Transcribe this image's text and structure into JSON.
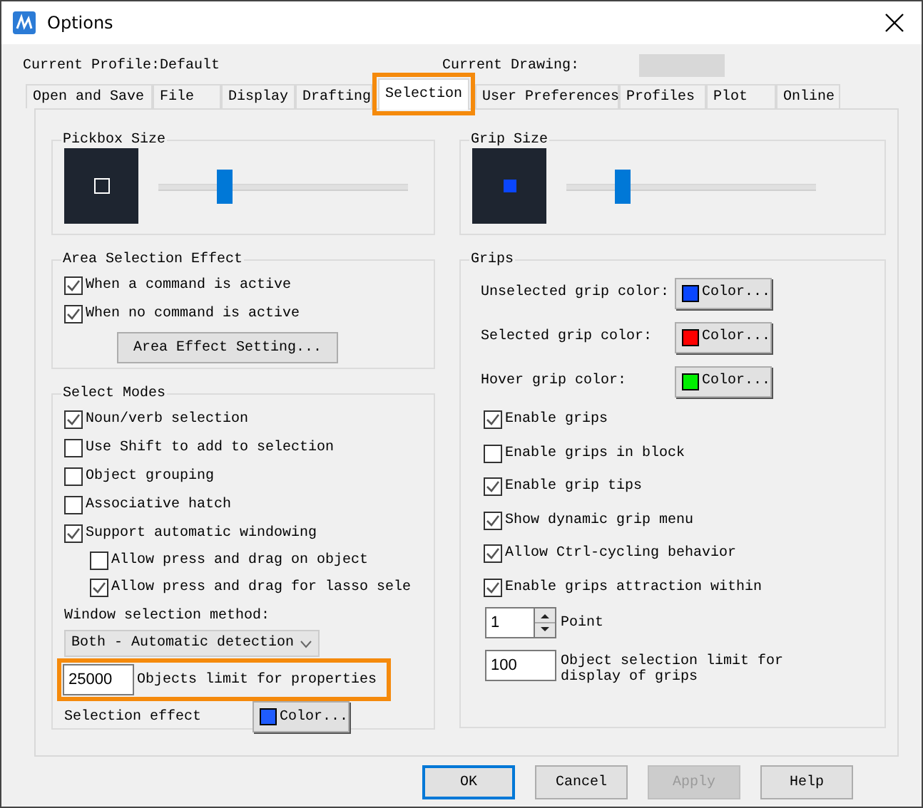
{
  "window": {
    "title": "Options"
  },
  "current_profile": "Current Profile:Default",
  "current_drawing_label": "Current Drawing:",
  "tabs": [
    {
      "label": "Open and Save",
      "selected": false,
      "highlighted": false
    },
    {
      "label": "File",
      "selected": false,
      "highlighted": false
    },
    {
      "label": "Display",
      "selected": false,
      "highlighted": false
    },
    {
      "label": "Drafting",
      "selected": false,
      "highlighted": false
    },
    {
      "label": "Selection",
      "selected": true,
      "highlighted": true
    },
    {
      "label": "User Preferences",
      "selected": false,
      "highlighted": false
    },
    {
      "label": "Profiles",
      "selected": false,
      "highlighted": false
    },
    {
      "label": "Plot",
      "selected": false,
      "highlighted": false
    },
    {
      "label": "Online",
      "selected": false,
      "highlighted": false
    }
  ],
  "pickbox_size": {
    "title": "Pickbox Size",
    "level": 0.26
  },
  "area_selection_effect": {
    "title": "Area Selection Effect",
    "checkboxes": [
      {
        "label": "When a command is active",
        "checked": true
      },
      {
        "label": "When no command is active",
        "checked": true
      }
    ],
    "button": "Area Effect Setting..."
  },
  "select_modes": {
    "title": "Select Modes",
    "checkboxes": [
      {
        "label": "Noun/verb selection",
        "checked": true
      },
      {
        "label": "Use Shift to add to selection",
        "checked": false
      },
      {
        "label": "Object grouping",
        "checked": false
      },
      {
        "label": "Associative hatch",
        "checked": false
      },
      {
        "label": "Support automatic windowing",
        "checked": true,
        "children": [
          {
            "label": "Allow press and drag on object",
            "checked": false
          },
          {
            "label": "Allow press and drag for lasso sele",
            "checked": true
          }
        ]
      }
    ],
    "window_selection_method": {
      "label": "Window selection method:",
      "value": "Both - Automatic detection"
    },
    "objects_limit": {
      "value": "25000",
      "label": "Objects limit for properties",
      "highlighted": true
    },
    "selection_effect": {
      "label": "Selection effect",
      "color": "#1f5cff",
      "button": "Color..."
    }
  },
  "grip_size": {
    "title": "Grip Size",
    "level": 0.22
  },
  "grips": {
    "title": "Grips",
    "colors": [
      {
        "label": "Unselected grip color:",
        "color": "#0a46ff",
        "button": "Color..."
      },
      {
        "label": "Selected grip color:",
        "color": "#ff0000",
        "button": "Color..."
      },
      {
        "label": "Hover grip color:",
        "color": "#00ee00",
        "button": "Color..."
      }
    ],
    "checkboxes": [
      {
        "label": "Enable grips",
        "checked": true
      },
      {
        "label": "Enable grips in block",
        "checked": false
      },
      {
        "label": "Enable grip tips",
        "checked": true
      },
      {
        "label": "Show dynamic grip menu",
        "checked": true
      },
      {
        "label": "Allow Ctrl-cycling behavior",
        "checked": true
      },
      {
        "label": "Enable grips attraction within",
        "checked": true
      }
    ],
    "point": {
      "value": "1",
      "label": "Point"
    },
    "grip_limit": {
      "value": "100",
      "label": "Object selection limit for display of grips"
    }
  },
  "buttons": [
    {
      "label": "OK",
      "default": true,
      "disabled": false
    },
    {
      "label": "Cancel",
      "default": false,
      "disabled": false
    },
    {
      "label": "Apply",
      "default": false,
      "disabled": true
    },
    {
      "label": "Help",
      "default": false,
      "disabled": false
    }
  ]
}
